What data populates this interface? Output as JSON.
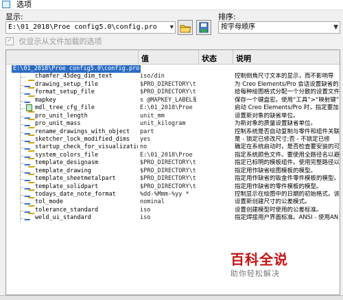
{
  "window": {
    "title": "选项"
  },
  "display": {
    "label": "显示:",
    "value": "E:\\01_2018\\Proe config5.0\\config.pro"
  },
  "sort": {
    "label": "排序:",
    "value": "按字母顺序"
  },
  "show_loaded_only": {
    "label": "仅显示从文件加载的选项",
    "checked": true
  },
  "columns": {
    "name": "",
    "value": "值",
    "status": "状态",
    "description": "说明"
  },
  "root": {
    "label": "E:\\01_2018\\Proe config5.0\\config.pro"
  },
  "rows": [
    {
      "icon": "none",
      "name": "chamfer_45deg_dim_text",
      "value": "iso/din",
      "desc": "控制倒角尺寸文本的显示，而不影响导"
    },
    {
      "icon": "pen",
      "name": "drawing_setup_file",
      "value": "$PRO_DIRECTORY\\te...",
      "desc": "为 Creo Elements/Pro 会话设置缺省的"
    },
    {
      "icon": "pen",
      "name": "format_setup_file",
      "value": "$PRO_DIRECTORY\\te...",
      "desc": "给每种绘图格式分配一个分散的设置文件"
    },
    {
      "icon": "pen",
      "name": "mapkey",
      "value": "s @MAPKEY_LABEL草...",
      "desc": "保存一个键盘宏。使用“工具”>“映射键”"
    },
    {
      "icon": "doc",
      "name": "mdl_tree_cfg_file",
      "value": "E:\\01_2018\\Proe c...",
      "desc": "启动 Creo Elements/Pro 时，指定要加"
    },
    {
      "icon": "pen",
      "name": "pro_unit_length",
      "value": "unit_mm",
      "desc": "设置新对象的缺省单位。"
    },
    {
      "icon": "pen",
      "name": "pro_unit_mass",
      "value": "unit_kilogram",
      "desc": "为新对象的质量设置缺省单位。"
    },
    {
      "icon": "pen",
      "name": "rename_drawings_with_object",
      "value": "part",
      "desc": "控制系统是否自动复制与零件和组件关联"
    },
    {
      "icon": "pen",
      "name": "sketcher_lock_modified_dims",
      "value": "yes",
      "desc": "是 - 锁定已修改尺寸;否 - 不锁定已修"
    },
    {
      "icon": "pen",
      "name": "startup_check_for_visualization",
      "value": "no",
      "desc": "确定在系统启动时，是否检查要安装的可"
    },
    {
      "icon": "pen",
      "name": "system_colors_file",
      "value": "E:\\01_2018\\Proe c...",
      "desc": "指定系统颜色文件。要使用全路径名以避"
    },
    {
      "icon": "pen",
      "name": "template_designasm",
      "value": "$PRO_DIRECTORY\\te...",
      "desc": "指定已标明的模板组件。使用完整路径以"
    },
    {
      "icon": "pen",
      "name": "template_drawing",
      "value": "$PRO_DIRECTORY\\te...",
      "desc": "指定用作缺省绘图模板的模型。"
    },
    {
      "icon": "pen",
      "name": "template_sheetmetalpart",
      "value": "$PRO_DIRECTORY\\te...",
      "desc": "指定用作缺省的钣金件零件模板的模型。"
    },
    {
      "icon": "pen",
      "name": "template_solidpart",
      "value": "$PRO_DIRECTORY\\te...",
      "desc": "指定用作缺省的零件模板的模型。"
    },
    {
      "icon": "pen",
      "name": "todays_date_note_format",
      "value": "%dd-%Mmm-%yy *",
      "desc": "控制显示在绘图中的日期的初始格式。该"
    },
    {
      "icon": "pen",
      "name": "tol_mode",
      "value": "nominal",
      "desc": "设置新创建尺寸的公差模式。"
    },
    {
      "icon": "pen",
      "name": "tolerance_standard",
      "value": "iso",
      "desc": "设置创建模型时使用的公差标准。"
    },
    {
      "icon": "pen",
      "name": "weld_ui_standard",
      "value": "iso",
      "desc": "指定焊接用户界面标准。ANSI - 使用AN"
    }
  ],
  "watermark": {
    "big": "百科全说",
    "small": "助你轻松解决"
  },
  "colors": {
    "selection": "#2b6cc4",
    "watermark": "#c51414"
  }
}
